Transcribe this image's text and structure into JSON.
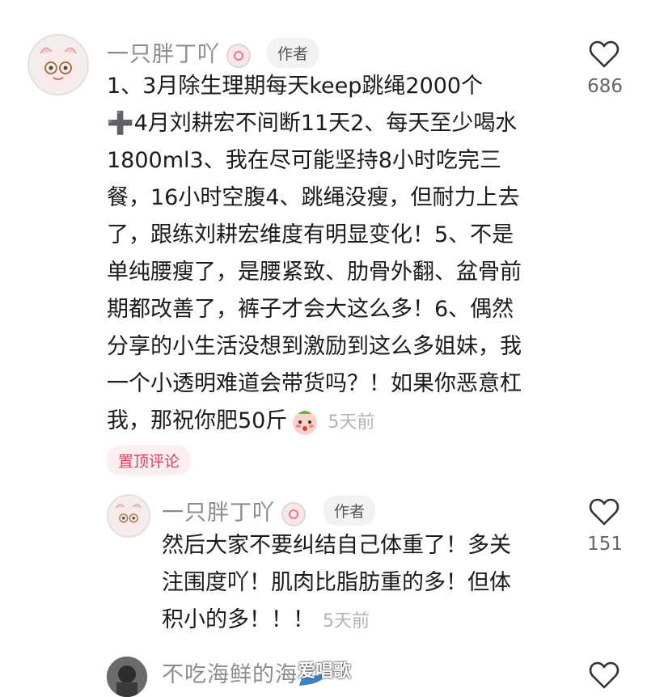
{
  "comment1": {
    "username": "一只胖丁吖",
    "author_tag": "作者",
    "lines": [
      "1、3月除生理期每天keep跳绳2000个",
      "➕4月刘耕宏不间断11天2、每天至少喝水",
      "1800ml3、我在尽可能坚持8小时吃完三",
      "餐，16小时空腹4、跳绳没瘦，但耐力上去",
      "了，跟练刘耕宏维度有明显变化！5、不是",
      "单纯腰瘦了，是腰紧致、肋骨外翻、盆骨前",
      "期都改善了，裤子才会大这么多！6、偶然",
      "分享的小生活没想到激励到这么多姐妹，我",
      "一个小透明难道会带货吗？！如果你恶意杠"
    ],
    "last_line": "我，那祝你肥50斤",
    "time": "5天前",
    "likes": "686",
    "pin_label": "置顶评论"
  },
  "reply1": {
    "username": "一只胖丁吖",
    "author_tag": "作者",
    "lines": [
      "然后大家不要纠结自己体重了！多关",
      "注围度吖！肌肉比脂肪重的多！但体"
    ],
    "last_line": "积小的多！！！",
    "time": "5天前",
    "likes": "151"
  },
  "reply2": {
    "username": "不吃海鲜的海"
  },
  "watermark": "爱唱歌",
  "colors": {
    "pin_text": "#e0405d",
    "pin_bg": "#fdeef0",
    "name_gray": "#8c8c8c",
    "time_gray": "#b3b3b3"
  },
  "icons": [
    "heart-icon",
    "cake-badge-icon",
    "blush-face-emoji",
    "wave-emoji"
  ]
}
